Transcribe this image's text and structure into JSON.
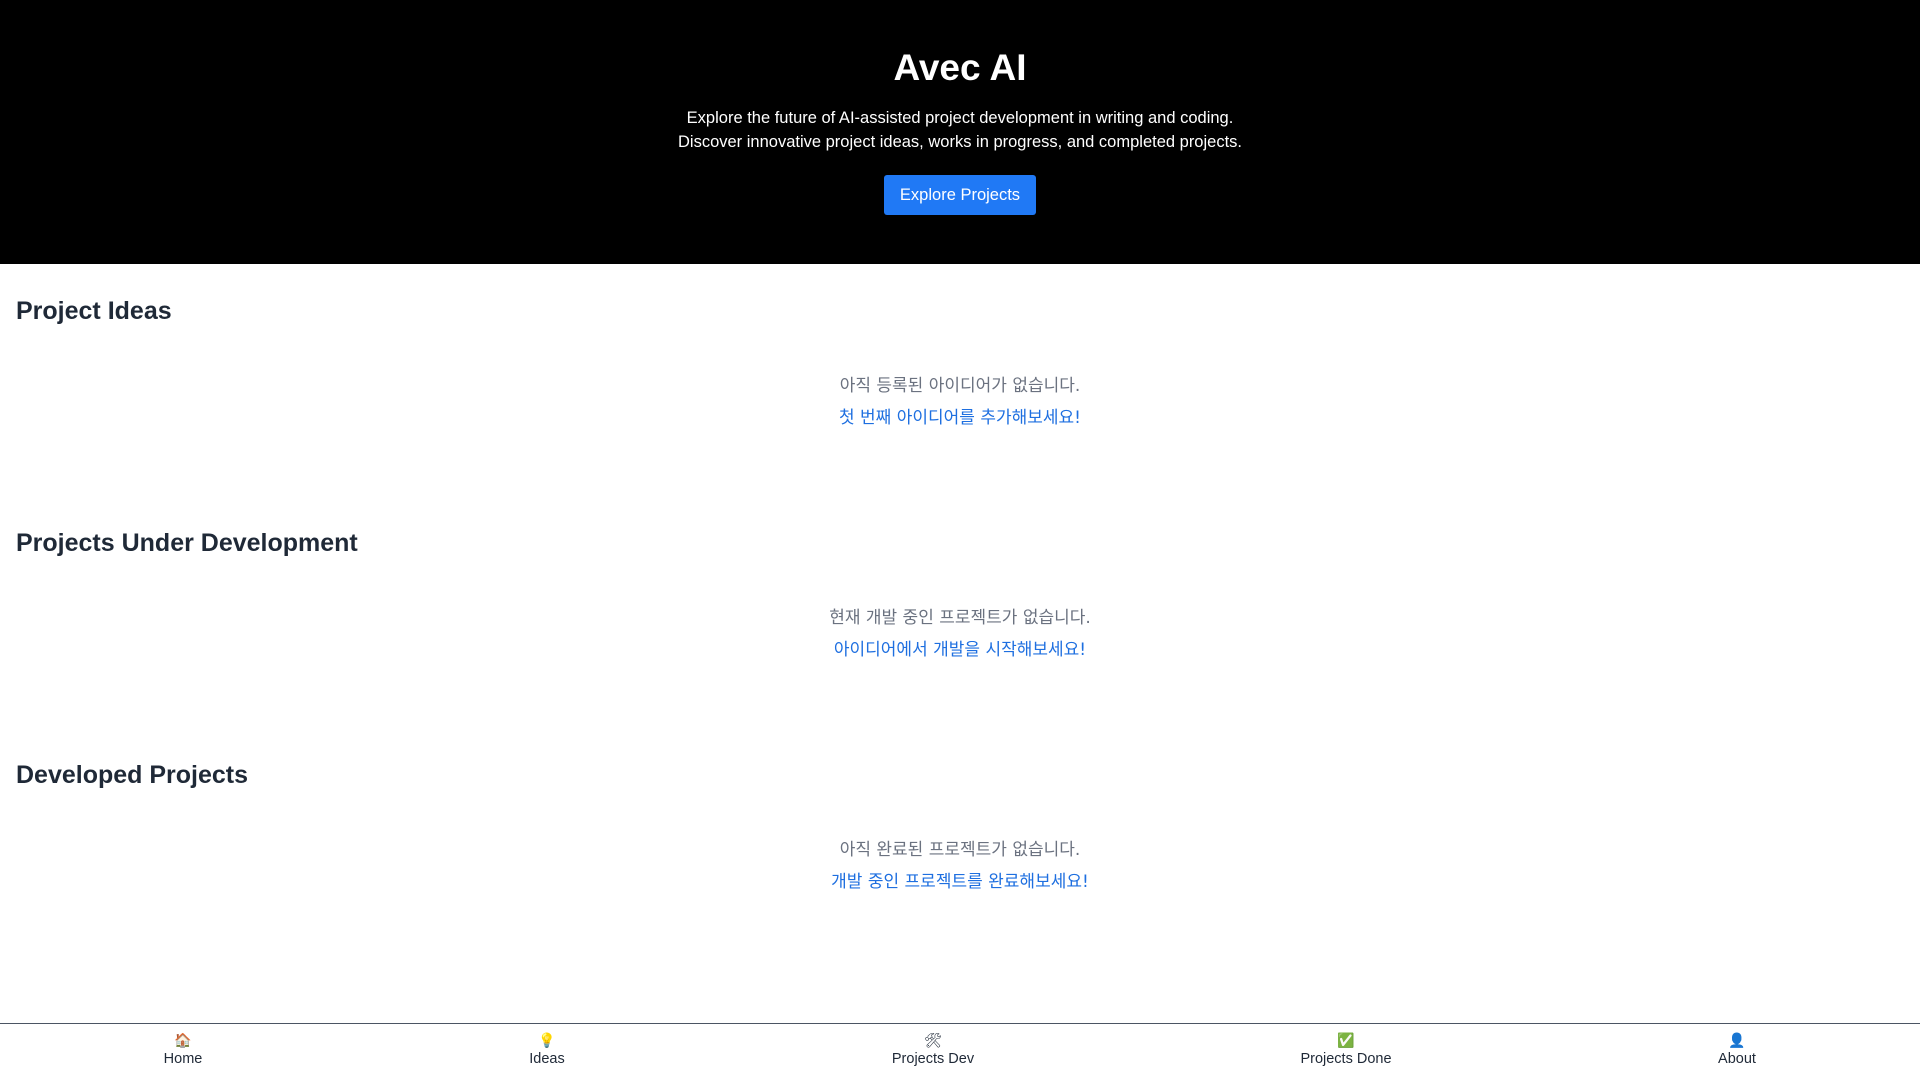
{
  "hero": {
    "title": "Avec AI",
    "line1": "Explore the future of AI-assisted project development in writing and coding.",
    "line2": "Discover innovative project ideas, works in progress, and completed projects.",
    "cta_label": "Explore Projects"
  },
  "sections": [
    {
      "title": "Project Ideas",
      "empty_message": "아직 등록된 아이디어가 없습니다.",
      "empty_hint": "첫 번째 아이디어를 추가해보세요!"
    },
    {
      "title": "Projects Under Development",
      "empty_message": "현재 개발 중인 프로젝트가 없습니다.",
      "empty_hint": "아이디어에서 개발을 시작해보세요!"
    },
    {
      "title": "Developed Projects",
      "empty_message": "아직 완료된 프로젝트가 없습니다.",
      "empty_hint": "개발 중인 프로젝트를 완료해보세요!"
    }
  ],
  "bottom_nav": [
    {
      "icon": "🏠",
      "icon_name": "home-icon",
      "label": "Home"
    },
    {
      "icon": "💡",
      "icon_name": "lightbulb-icon",
      "label": "Ideas"
    },
    {
      "icon": "🛠",
      "icon_name": "tools-icon",
      "label": "Projects Dev"
    },
    {
      "icon": "✅",
      "icon_name": "check-icon",
      "label": "Projects Done"
    },
    {
      "icon": "👤",
      "icon_name": "user-icon",
      "label": "About"
    }
  ],
  "colors": {
    "hero_background": "#000000",
    "accent": "#2079f5",
    "hint_link": "#1e6fe0",
    "muted_text": "#6b7280"
  }
}
